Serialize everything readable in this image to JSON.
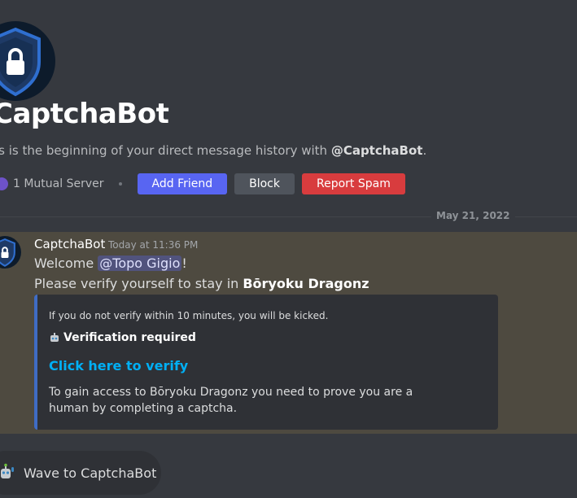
{
  "profile": {
    "name": "CaptchaBot",
    "intro_prefix": "is is the beginning of your direct message history with ",
    "intro_handle": "@CaptchaBot",
    "intro_suffix": ".",
    "mutual_servers": "1 Mutual Server",
    "add_friend_label": "Add Friend",
    "block_label": "Block",
    "report_spam_label": "Report Spam"
  },
  "divider": {
    "date": "May 21, 2022"
  },
  "message": {
    "author": "CaptchaBot",
    "timestamp": "Today at 11:36 PM",
    "welcome": "Welcome ",
    "mention": "@Topo Gigio",
    "welcome_suffix": "!",
    "verify_prefix": "Please verify yourself to stay in ",
    "server_name": "Bōryoku Dragonz",
    "embed": {
      "author": "If you do not verify within 10 minutes, you will be kicked.",
      "title": "Verification required",
      "link": "Click here to verify",
      "description": "To gain access to Bōryoku Dragonz you need to prove you are a human by completing a captcha."
    }
  },
  "wave": {
    "label": "Wave to CaptchaBot"
  },
  "colors": {
    "background": "#36393f",
    "highlight": "#4e4a40",
    "blurple": "#5865f2",
    "danger": "#d83c3e",
    "link": "#00aff4",
    "embed_bar": "#3f6cc4"
  },
  "icons": {
    "avatar": "shield-lock-icon",
    "mutual": "server-icon",
    "embed_title": "robot-icon",
    "wave": "waving-robot-icon"
  }
}
